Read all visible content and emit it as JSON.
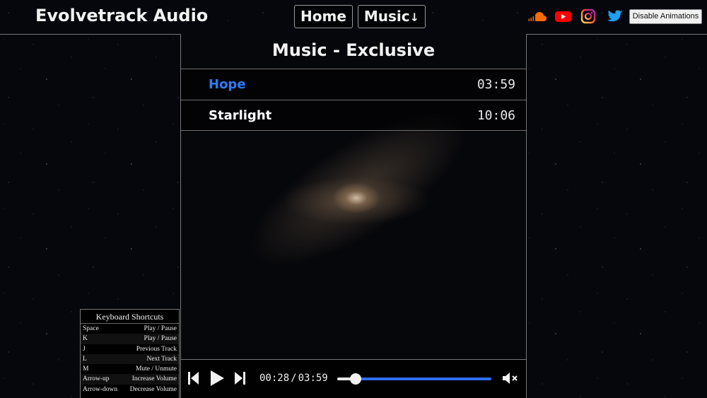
{
  "header": {
    "brand": "Evolvetrack Audio",
    "nav": [
      {
        "label": "Home"
      },
      {
        "label": "Music",
        "arrow": "↓"
      }
    ],
    "social": [
      "soundcloud-icon",
      "youtube-icon",
      "instagram-icon",
      "twitter-icon"
    ],
    "disable_animations_label": "Disable Animations"
  },
  "main": {
    "title": "Music - Exclusive",
    "tracks": [
      {
        "name": "Hope",
        "duration": "03:59",
        "active": true
      },
      {
        "name": "Starlight",
        "duration": "10:06",
        "active": false
      }
    ]
  },
  "player": {
    "current_time": "00:28",
    "separator": "/",
    "total_time": "03:59",
    "progress": 0.117,
    "muted": true
  },
  "shortcuts": {
    "title": "Keyboard Shortcuts",
    "rows": [
      {
        "key": "Space",
        "action": "Play / Pause"
      },
      {
        "key": "K",
        "action": "Play / Pause"
      },
      {
        "key": "J",
        "action": "Previous Track"
      },
      {
        "key": "L",
        "action": "Next Track"
      },
      {
        "key": "M",
        "action": "Mute / Unmute"
      },
      {
        "key": "Arrow-up",
        "action": "Increase Volume"
      },
      {
        "key": "Arrow-down",
        "action": "Decrease Volume"
      }
    ]
  },
  "colors": {
    "accent": "#2f7bf6",
    "soundcloud": "#ff6a00",
    "youtube": "#ff0000",
    "instagram": "#e1306c",
    "twitter": "#1da1f2"
  }
}
